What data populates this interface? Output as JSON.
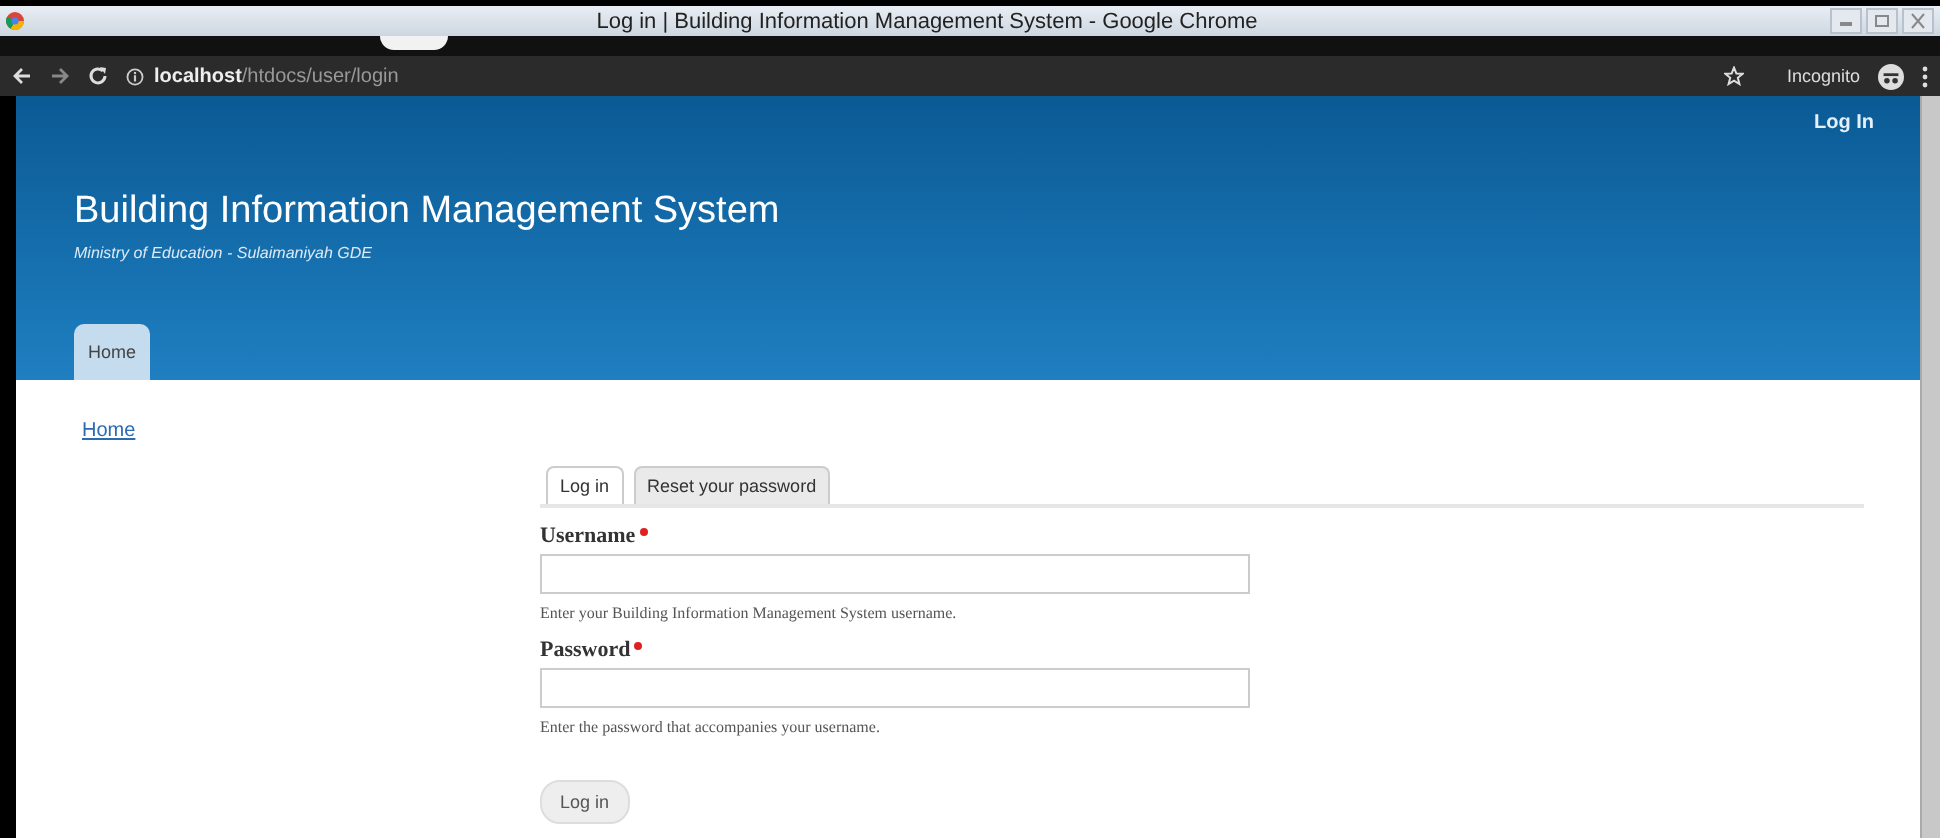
{
  "window": {
    "title": "Log in | Building Information Management System - Google Chrome"
  },
  "browser": {
    "url_host": "localhost",
    "url_path": "/htdocs/user/login",
    "profile": "Incognito"
  },
  "header": {
    "user_link": "Log In",
    "site_name": "Building Information Management System",
    "slogan": "Ministry of Education - Sulaimaniyah GDE",
    "nav": [
      {
        "label": "Home",
        "selected": true
      }
    ]
  },
  "breadcrumb": [
    "Home"
  ],
  "tabs": [
    {
      "label": "Log in",
      "selected": true
    },
    {
      "label": "Reset your password",
      "selected": false
    }
  ],
  "fields": [
    {
      "label": "Username",
      "required": true,
      "description": "Enter your Building Information Management System username."
    },
    {
      "label": "Password",
      "required": true,
      "description": "Enter the password that accompanies your username."
    }
  ],
  "submit": "Log in"
}
